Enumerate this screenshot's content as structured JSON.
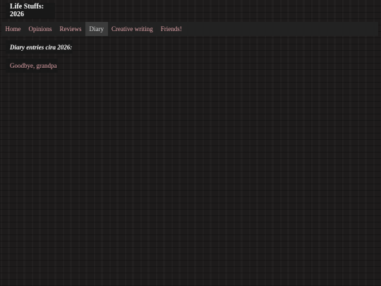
{
  "site": {
    "title": "Life Stuffs: 2026"
  },
  "nav": {
    "items": [
      {
        "label": "Home"
      },
      {
        "label": "Opinions"
      },
      {
        "label": "Reviews"
      },
      {
        "label": "Diary"
      },
      {
        "label": "Creative writing"
      },
      {
        "label": "Friends!"
      }
    ],
    "active": "Diary"
  },
  "main": {
    "section_title": "Diary entries cira 2026:",
    "entries": [
      {
        "title": "Goodbye, grandpa"
      }
    ]
  },
  "colors": {
    "background": "#1d1b1b",
    "panel": "#181818",
    "navbar": "#222222",
    "nav_active": "#3b3b3b",
    "link": "#e2a4aa",
    "heading": "#ffffff"
  }
}
